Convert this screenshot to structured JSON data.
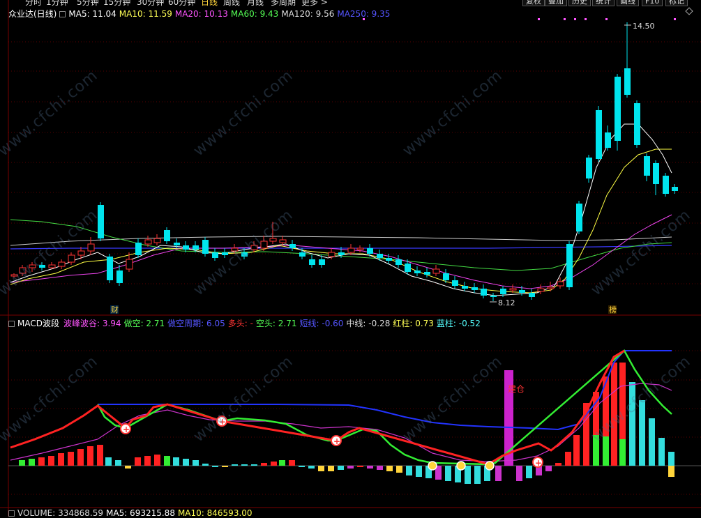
{
  "top_nav": {
    "periods": [
      "分时",
      "1分钟",
      "5分钟",
      "15分钟",
      "30分钟",
      "60分钟",
      "日线",
      "周线",
      "月线",
      "多周期",
      "更多 >"
    ],
    "active_period": "日线",
    "buttons": [
      "复权",
      "叠加",
      "历史",
      "统计",
      "画线",
      "F10",
      "标记"
    ]
  },
  "price_panel": {
    "stock_name": "众业达(日线)",
    "ma_legend": [
      {
        "label": "MA5: 11.04",
        "color": "#ffffff"
      },
      {
        "label": "MA10: 11.59",
        "color": "#ffff55"
      },
      {
        "label": "MA20: 10.13",
        "color": "#ff55ff"
      },
      {
        "label": "MA60: 9.43",
        "color": "#55ff55"
      },
      {
        "label": "MA120: 9.56",
        "color": "#dddddd"
      },
      {
        "label": "MA250: 9.35",
        "color": "#5555ff"
      }
    ],
    "high_label": "14.50",
    "low_label": "8.12",
    "markers": [
      {
        "text": "财"
      },
      {
        "text": "榜"
      }
    ]
  },
  "macd_panel": {
    "name": "MACD波段",
    "legend": [
      {
        "label": "波峰波谷: 3.94",
        "color": "#ff55ff"
      },
      {
        "label": "做空: 2.71",
        "color": "#55ff55"
      },
      {
        "label": "做空周期: 6.05",
        "color": "#5555ff"
      },
      {
        "label": "多头: -",
        "color": "#ff3333"
      },
      {
        "label": "空头: 2.71",
        "color": "#55ff55"
      },
      {
        "label": "短线: -0.60",
        "color": "#5555ff"
      },
      {
        "label": "中线: -0.28",
        "color": "#dddddd"
      },
      {
        "label": "红柱: 0.73",
        "color": "#ffff55"
      },
      {
        "label": "蓝柱: -0.52",
        "color": "#55ffff"
      }
    ],
    "signal_label": "建仓"
  },
  "volume_panel": {
    "legend": [
      {
        "label": "VOLUME: 334868.59",
        "color": "#dddddd"
      },
      {
        "label": "MA5: 693215.88",
        "color": "#ffffff"
      },
      {
        "label": "MA10: 846593.00",
        "color": "#ffff55"
      }
    ]
  },
  "watermark": "www.cfchi.com",
  "colors": {
    "up": "#ff3333",
    "down": "#00e5ee",
    "background": "#000000"
  }
}
